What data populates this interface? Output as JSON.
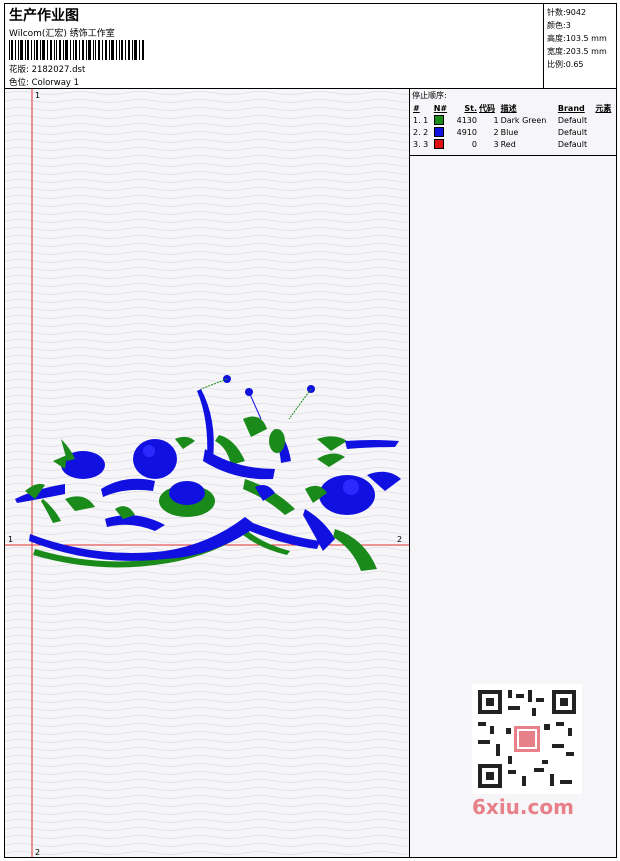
{
  "header": {
    "title": "生产作业图",
    "company": "Wilcom(汇宏) 绣饰工作室",
    "pattern_label": "花版:",
    "pattern_value": "2182027.dst",
    "colorway_label": "色位:",
    "colorway_value": "Colorway 1"
  },
  "stats": {
    "stitches_label": "针数:",
    "stitches": "9042",
    "colors_label": "颜色:",
    "colors": "3",
    "height_label": "高度:",
    "height": "103.5 mm",
    "width_label": "宽度:",
    "width": "203.5 mm",
    "scale_label": "比例:",
    "scale": "0.65"
  },
  "stop_sequence": {
    "heading": "停止顺序:",
    "columns": [
      "#",
      "N#",
      "St.",
      "代码",
      "描述",
      "Brand",
      "元素"
    ],
    "rows": [
      {
        "num": "1. 1",
        "color": "#1a8a1a",
        "st": "4130",
        "code": "1",
        "desc": "Dark Green",
        "brand": "Default",
        "element": ""
      },
      {
        "num": "2. 2",
        "color": "#1010e0",
        "st": "4910",
        "code": "2",
        "desc": "Blue",
        "brand": "Default",
        "element": ""
      },
      {
        "num": "3. 3",
        "color": "#e01010",
        "st": "0",
        "code": "3",
        "desc": "Red",
        "brand": "Default",
        "element": ""
      }
    ]
  },
  "axis_markers": {
    "top": "1",
    "left": "1",
    "right": "2",
    "bottom": "2"
  },
  "watermark": "6xiu.com",
  "colors": {
    "green": "#1a8a1a",
    "blue": "#1010e0",
    "red": "#e01010",
    "axis": "#e03030"
  }
}
